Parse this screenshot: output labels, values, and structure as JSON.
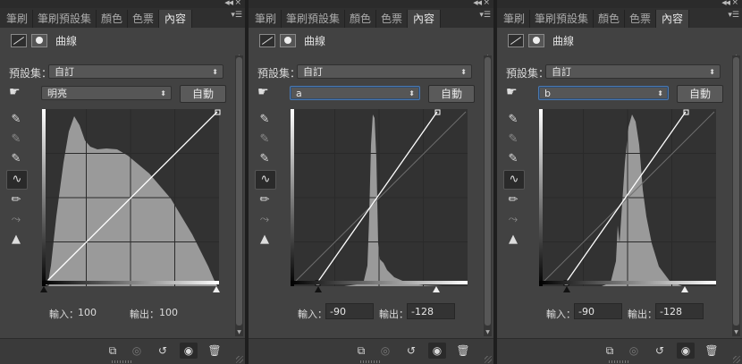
{
  "panels": [
    {
      "tabs": [
        "筆刷",
        "筆刷預設集",
        "顏色",
        "色票",
        "內容"
      ],
      "active_tab": 4,
      "header_title": "曲線",
      "preset_label": "預設集：",
      "preset_value": "自訂",
      "channel_value": "明亮",
      "auto_label": "自動",
      "input_label": "輸入：",
      "input_value": "100",
      "output_label": "輸出：",
      "output_value": "100",
      "mode": "text"
    },
    {
      "tabs": [
        "筆刷",
        "筆刷預設集",
        "顏色",
        "色票",
        "內容"
      ],
      "active_tab": 4,
      "header_title": "曲線",
      "preset_label": "預設集：",
      "preset_value": "自訂",
      "channel_value": "a",
      "auto_label": "自動",
      "input_label": "輸入：",
      "input_value": "-90",
      "output_label": "輸出：",
      "output_value": "-128",
      "mode": "field"
    },
    {
      "tabs": [
        "筆刷",
        "筆刷預設集",
        "顏色",
        "色票",
        "內容"
      ],
      "active_tab": 4,
      "header_title": "曲線",
      "preset_label": "預設集：",
      "preset_value": "自訂",
      "channel_value": "b",
      "auto_label": "自動",
      "input_label": "輸入：",
      "input_value": "-90",
      "output_label": "輸出：",
      "output_value": "-128",
      "mode": "field"
    }
  ],
  "icons": {
    "hand": "hand-target-icon",
    "tools": [
      "eyedropper-black-icon",
      "eyedropper-gray-icon",
      "eyedropper-white-icon",
      "curve-point-icon",
      "pencil-icon",
      "smooth-icon",
      "clip-warning-icon"
    ],
    "footer": [
      "clip-to-layer-icon",
      "view-previous-icon",
      "reset-icon",
      "visibility-eye-icon",
      "trash-icon"
    ]
  },
  "colors": {
    "panel_bg": "#424242",
    "graph_bg": "#323232",
    "histogram": "#9a9a9a",
    "curve": "#ffffff",
    "focus_border": "#4a78b0"
  }
}
